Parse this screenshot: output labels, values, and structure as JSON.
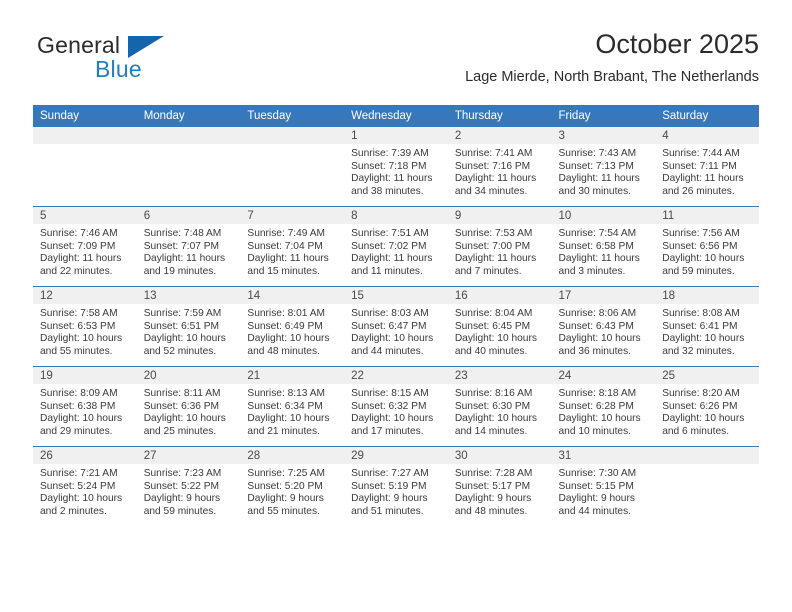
{
  "brand": {
    "name_part1": "General",
    "name_part2": "Blue",
    "logo_icon": "blue-triangle-icon"
  },
  "header": {
    "title": "October 2025",
    "location": "Lage Mierde, North Brabant, The Netherlands"
  },
  "colors": {
    "header_blue": "#3778bc",
    "brand_blue": "#1e7fc6",
    "logo_blue": "#1565ad",
    "daynum_band": "#f0f0f0",
    "text": "#3a3a3a"
  },
  "weekday_headers": [
    "Sunday",
    "Monday",
    "Tuesday",
    "Wednesday",
    "Thursday",
    "Friday",
    "Saturday"
  ],
  "weeks": [
    [
      {
        "day": "",
        "lines": []
      },
      {
        "day": "",
        "lines": []
      },
      {
        "day": "",
        "lines": []
      },
      {
        "day": "1",
        "lines": [
          "Sunrise: 7:39 AM",
          "Sunset: 7:18 PM",
          "Daylight: 11 hours",
          "and 38 minutes."
        ]
      },
      {
        "day": "2",
        "lines": [
          "Sunrise: 7:41 AM",
          "Sunset: 7:16 PM",
          "Daylight: 11 hours",
          "and 34 minutes."
        ]
      },
      {
        "day": "3",
        "lines": [
          "Sunrise: 7:43 AM",
          "Sunset: 7:13 PM",
          "Daylight: 11 hours",
          "and 30 minutes."
        ]
      },
      {
        "day": "4",
        "lines": [
          "Sunrise: 7:44 AM",
          "Sunset: 7:11 PM",
          "Daylight: 11 hours",
          "and 26 minutes."
        ]
      }
    ],
    [
      {
        "day": "5",
        "lines": [
          "Sunrise: 7:46 AM",
          "Sunset: 7:09 PM",
          "Daylight: 11 hours",
          "and 22 minutes."
        ]
      },
      {
        "day": "6",
        "lines": [
          "Sunrise: 7:48 AM",
          "Sunset: 7:07 PM",
          "Daylight: 11 hours",
          "and 19 minutes."
        ]
      },
      {
        "day": "7",
        "lines": [
          "Sunrise: 7:49 AM",
          "Sunset: 7:04 PM",
          "Daylight: 11 hours",
          "and 15 minutes."
        ]
      },
      {
        "day": "8",
        "lines": [
          "Sunrise: 7:51 AM",
          "Sunset: 7:02 PM",
          "Daylight: 11 hours",
          "and 11 minutes."
        ]
      },
      {
        "day": "9",
        "lines": [
          "Sunrise: 7:53 AM",
          "Sunset: 7:00 PM",
          "Daylight: 11 hours",
          "and 7 minutes."
        ]
      },
      {
        "day": "10",
        "lines": [
          "Sunrise: 7:54 AM",
          "Sunset: 6:58 PM",
          "Daylight: 11 hours",
          "and 3 minutes."
        ]
      },
      {
        "day": "11",
        "lines": [
          "Sunrise: 7:56 AM",
          "Sunset: 6:56 PM",
          "Daylight: 10 hours",
          "and 59 minutes."
        ]
      }
    ],
    [
      {
        "day": "12",
        "lines": [
          "Sunrise: 7:58 AM",
          "Sunset: 6:53 PM",
          "Daylight: 10 hours",
          "and 55 minutes."
        ]
      },
      {
        "day": "13",
        "lines": [
          "Sunrise: 7:59 AM",
          "Sunset: 6:51 PM",
          "Daylight: 10 hours",
          "and 52 minutes."
        ]
      },
      {
        "day": "14",
        "lines": [
          "Sunrise: 8:01 AM",
          "Sunset: 6:49 PM",
          "Daylight: 10 hours",
          "and 48 minutes."
        ]
      },
      {
        "day": "15",
        "lines": [
          "Sunrise: 8:03 AM",
          "Sunset: 6:47 PM",
          "Daylight: 10 hours",
          "and 44 minutes."
        ]
      },
      {
        "day": "16",
        "lines": [
          "Sunrise: 8:04 AM",
          "Sunset: 6:45 PM",
          "Daylight: 10 hours",
          "and 40 minutes."
        ]
      },
      {
        "day": "17",
        "lines": [
          "Sunrise: 8:06 AM",
          "Sunset: 6:43 PM",
          "Daylight: 10 hours",
          "and 36 minutes."
        ]
      },
      {
        "day": "18",
        "lines": [
          "Sunrise: 8:08 AM",
          "Sunset: 6:41 PM",
          "Daylight: 10 hours",
          "and 32 minutes."
        ]
      }
    ],
    [
      {
        "day": "19",
        "lines": [
          "Sunrise: 8:09 AM",
          "Sunset: 6:38 PM",
          "Daylight: 10 hours",
          "and 29 minutes."
        ]
      },
      {
        "day": "20",
        "lines": [
          "Sunrise: 8:11 AM",
          "Sunset: 6:36 PM",
          "Daylight: 10 hours",
          "and 25 minutes."
        ]
      },
      {
        "day": "21",
        "lines": [
          "Sunrise: 8:13 AM",
          "Sunset: 6:34 PM",
          "Daylight: 10 hours",
          "and 21 minutes."
        ]
      },
      {
        "day": "22",
        "lines": [
          "Sunrise: 8:15 AM",
          "Sunset: 6:32 PM",
          "Daylight: 10 hours",
          "and 17 minutes."
        ]
      },
      {
        "day": "23",
        "lines": [
          "Sunrise: 8:16 AM",
          "Sunset: 6:30 PM",
          "Daylight: 10 hours",
          "and 14 minutes."
        ]
      },
      {
        "day": "24",
        "lines": [
          "Sunrise: 8:18 AM",
          "Sunset: 6:28 PM",
          "Daylight: 10 hours",
          "and 10 minutes."
        ]
      },
      {
        "day": "25",
        "lines": [
          "Sunrise: 8:20 AM",
          "Sunset: 6:26 PM",
          "Daylight: 10 hours",
          "and 6 minutes."
        ]
      }
    ],
    [
      {
        "day": "26",
        "lines": [
          "Sunrise: 7:21 AM",
          "Sunset: 5:24 PM",
          "Daylight: 10 hours",
          "and 2 minutes."
        ]
      },
      {
        "day": "27",
        "lines": [
          "Sunrise: 7:23 AM",
          "Sunset: 5:22 PM",
          "Daylight: 9 hours",
          "and 59 minutes."
        ]
      },
      {
        "day": "28",
        "lines": [
          "Sunrise: 7:25 AM",
          "Sunset: 5:20 PM",
          "Daylight: 9 hours",
          "and 55 minutes."
        ]
      },
      {
        "day": "29",
        "lines": [
          "Sunrise: 7:27 AM",
          "Sunset: 5:19 PM",
          "Daylight: 9 hours",
          "and 51 minutes."
        ]
      },
      {
        "day": "30",
        "lines": [
          "Sunrise: 7:28 AM",
          "Sunset: 5:17 PM",
          "Daylight: 9 hours",
          "and 48 minutes."
        ]
      },
      {
        "day": "31",
        "lines": [
          "Sunrise: 7:30 AM",
          "Sunset: 5:15 PM",
          "Daylight: 9 hours",
          "and 44 minutes."
        ]
      },
      {
        "day": "",
        "lines": []
      }
    ]
  ]
}
